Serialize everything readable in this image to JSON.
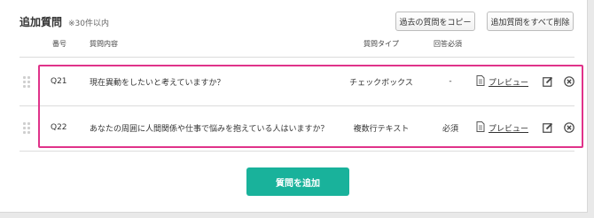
{
  "section": {
    "title": "追加質問",
    "subtitle": "※30件以内",
    "copy_button": "過去の質問をコピー",
    "delete_all_button": "追加質問をすべて削除"
  },
  "table": {
    "headers": {
      "number": "番号",
      "content": "質問内容",
      "type": "質問タイプ",
      "required": "回答必須"
    },
    "rows": [
      {
        "number": "Q21",
        "content": "現在異動をしたいと考えていますか？",
        "type": "チェックボックス",
        "required": "-",
        "preview": "プレビュー"
      },
      {
        "number": "Q22",
        "content": "あなたの周囲に人間関係や仕事で悩みを抱えている人はいますか？",
        "type": "複数行テキスト",
        "required": "必須",
        "preview": "プレビュー"
      }
    ]
  },
  "add_question_button": "質問を追加",
  "colors": {
    "accent": "#19b29b",
    "highlight": "#e0338a"
  },
  "icons": [
    "drag-handle-icon",
    "document-icon",
    "edit-icon",
    "delete-circle-icon"
  ]
}
